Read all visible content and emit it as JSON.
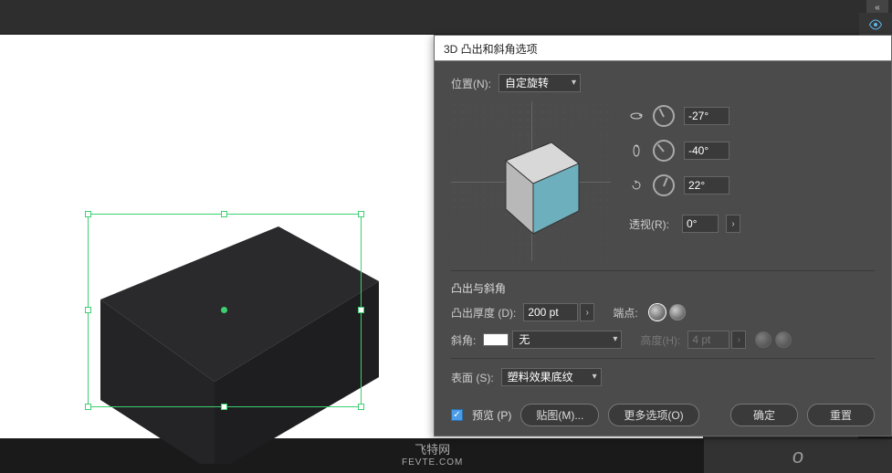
{
  "dialog": {
    "title": "3D 凸出和斜角选项",
    "position_label": "位置(N):",
    "position_value": "自定旋转",
    "rot_x": "-27°",
    "rot_y": "-40°",
    "rot_z": "22°",
    "perspective_label": "透视(R):",
    "perspective_value": "0°",
    "extrude_section": "凸出与斜角",
    "extrude_depth_label": "凸出厚度 (D):",
    "extrude_depth_value": "200 pt",
    "cap_label": "端点:",
    "bevel_label": "斜角:",
    "bevel_value": "无",
    "height_label": "高度(H):",
    "height_value": "4 pt",
    "surface_label": "表面 (S):",
    "surface_value": "塑料效果底纹",
    "preview_label": "预览 (P)",
    "map_btn": "贴图(M)...",
    "more_btn": "更多选项(O)",
    "ok_btn": "确定",
    "reset_btn": "重置"
  },
  "watermark": {
    "line1": "飞特网",
    "line2": "FEVTE.COM"
  },
  "bottom_char": "o"
}
